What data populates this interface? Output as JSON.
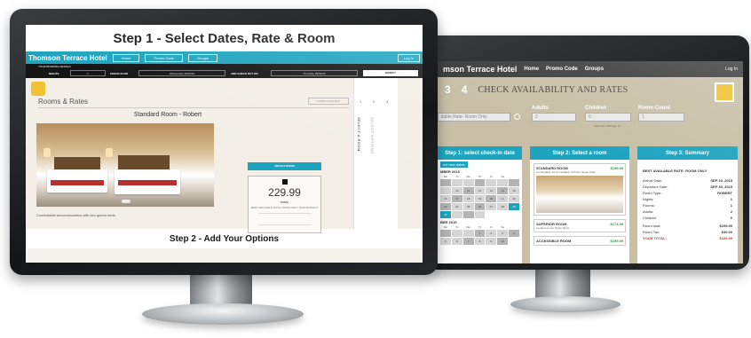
{
  "right_app": {
    "brand": "mson Terrace Hotel",
    "nav": [
      "Home",
      "Promo Code",
      "Groups"
    ],
    "login": "Log In",
    "steps": [
      "3",
      "4"
    ],
    "heading": "CHECK AVAILABILITY AND RATES",
    "form": {
      "rate_value": "ilable Rate- Room Only",
      "adults_label": "Adults",
      "adults_value": "2",
      "children_label": "Children",
      "children_value": "0",
      "children_hint": "Maximum child age 12",
      "room_count_label": "Room Count",
      "room_count_value": "1"
    },
    "col1": {
      "title": "Step 1: select check-in date",
      "button": "ect new dates",
      "month1": "MBER 2015",
      "month2": "BER 2015",
      "dow": [
        "Mo",
        "Tu",
        "We",
        "Th",
        "Fr",
        "Sa"
      ],
      "days1": [
        "",
        "",
        "",
        "",
        "",
        "",
        "",
        "",
        "10",
        "11",
        "12",
        "13",
        "14",
        "15",
        "16",
        "17",
        "18",
        "19",
        "20",
        "21",
        "22",
        "23",
        "24",
        "25",
        "26",
        "27",
        "28",
        "29",
        "30",
        "",
        "",
        ""
      ],
      "days2": [
        "",
        "",
        "",
        "1",
        "2",
        "3",
        "4",
        "5",
        "6",
        "7",
        "8",
        "9",
        "10"
      ]
    },
    "col2": {
      "title": "Step 2: Select a room",
      "rooms": [
        {
          "name": "STANDARD ROOM",
          "price": "$199.99",
          "desc": "Comfortable accommodation with two queen beds."
        },
        {
          "name": "SUPERIOR ROOM",
          "price": "$174.99",
          "desc": "Located on our higher floors"
        },
        {
          "name": "ACCESSIBLE ROOM",
          "price": "$199.99",
          "desc": ""
        }
      ]
    },
    "col3": {
      "title": "Step 3: Summary",
      "subtitle": "BEST AVAILABLE RATE- ROOM ONLY",
      "rows": [
        {
          "label": "Arrival Date:",
          "value": "SEP 29, 2015"
        },
        {
          "label": "Departure Date:",
          "value": "SEP 30, 2015"
        },
        {
          "label": "Room Type:",
          "value": "ROBERT"
        },
        {
          "label": "Nights:",
          "value": "1"
        },
        {
          "label": "Rooms:",
          "value": "1"
        },
        {
          "label": "Adults:",
          "value": "2"
        },
        {
          "label": "Children:",
          "value": "0"
        },
        {
          "label": "Room total:",
          "value": "$199.99"
        },
        {
          "label": "Room Tax:",
          "value": "$30.00"
        }
      ],
      "total_label": "YOUR TOTAL:",
      "total_value": "$229.99"
    }
  },
  "left_app": {
    "step1_title": "Step 1 - Select Dates, Rate & Room",
    "brand": "Thomson Terrace Hotel",
    "nav": [
      "Home",
      "Promo Code",
      "Groups"
    ],
    "login": "Log In",
    "booking": {
      "title": "YOUR BOOKING DETAILS",
      "nights_label": "NIGHTS",
      "nights_value": "1",
      "checkin_label": "CHECK IN ON",
      "checkin_value": "Wednesday 09/29/15",
      "checkout_label": "AND CHECK OUT ON",
      "checkout_value": "Thursday 09/30/15",
      "modify": "MODIFY"
    },
    "rooms_heading": "Rooms & Rates",
    "sort": "LOWEST-HIGHEST",
    "room_title": "Standard Room - Robert",
    "select_button": "SELECT ROOM",
    "price": "229.99",
    "price_label": "TOTAL",
    "rate_line": "BEST AVAILABLE RATE- ROOM ONLY: $199.99/NIGHT",
    "caption": "Comfortable accommodation with two queen beds.",
    "side_nums": [
      "1",
      "2",
      "3"
    ],
    "side_label1": "SELECT A ROOM",
    "side_label2": "SELECT OPTIONS",
    "step2_title": "Step 2 - Add Your Options"
  }
}
